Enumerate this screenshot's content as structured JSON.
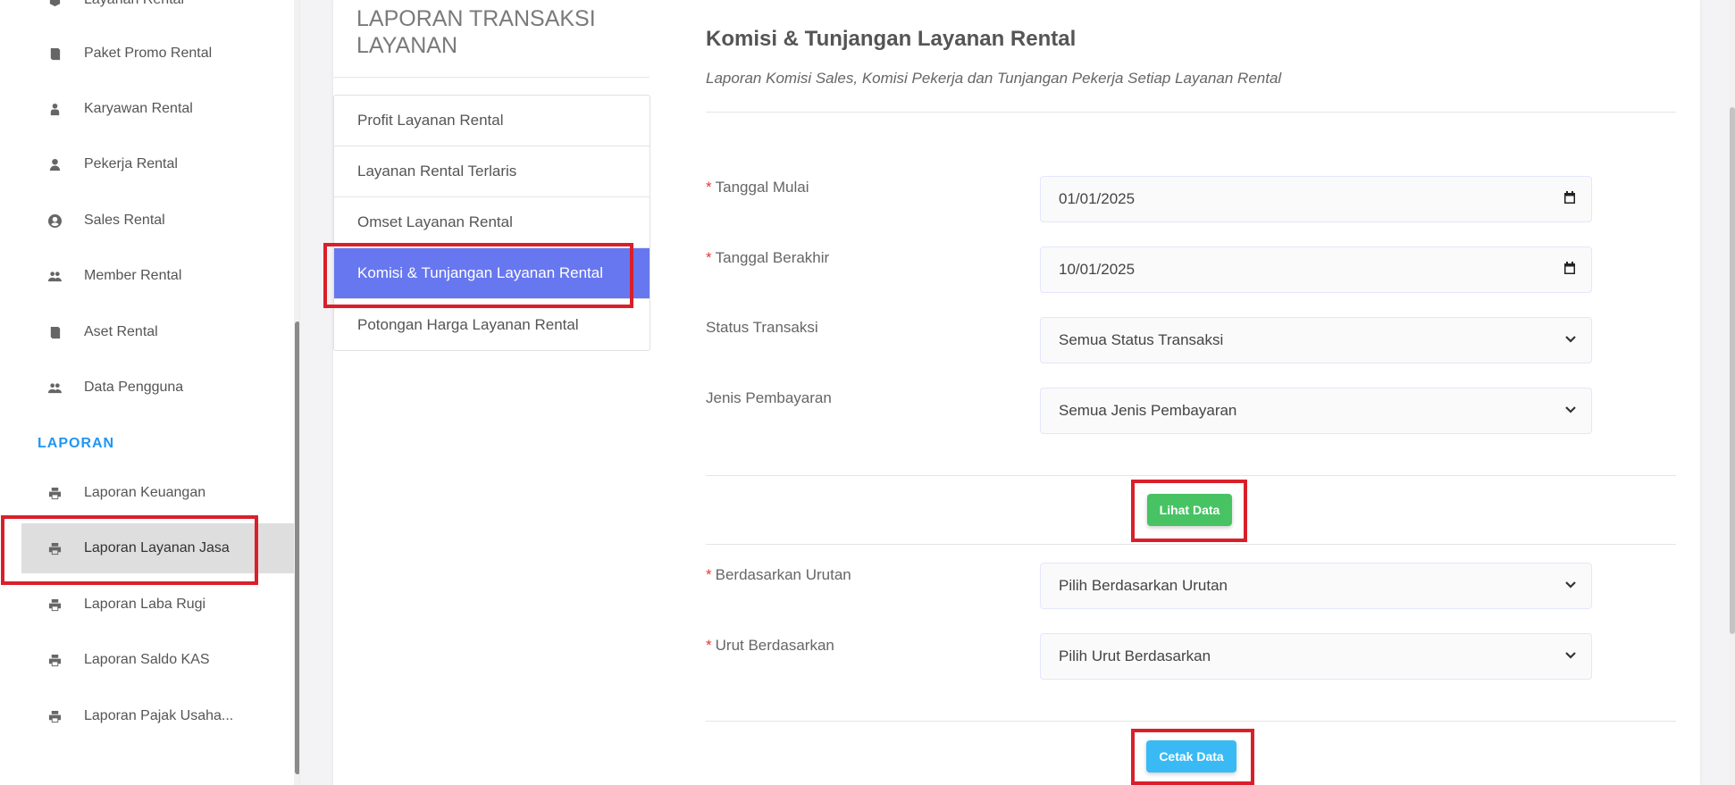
{
  "sidebar": {
    "items": [
      {
        "label": "Layanan Rental",
        "icon": "cube-icon"
      },
      {
        "label": "Paket Promo Rental",
        "icon": "book-icon"
      },
      {
        "label": "Karyawan Rental",
        "icon": "user-tie-icon"
      },
      {
        "label": "Pekerja Rental",
        "icon": "user-icon"
      },
      {
        "label": "Sales Rental",
        "icon": "user-circle-icon"
      },
      {
        "label": "Member Rental",
        "icon": "users-icon"
      },
      {
        "label": "Aset Rental",
        "icon": "book-icon"
      },
      {
        "label": "Data Pengguna",
        "icon": "users-icon"
      }
    ],
    "section_label": "LAPORAN",
    "report_items": [
      {
        "label": "Laporan Keuangan",
        "icon": "print-icon"
      },
      {
        "label": "Laporan Layanan Jasa",
        "icon": "print-icon"
      },
      {
        "label": "Laporan Laba Rugi",
        "icon": "print-icon"
      },
      {
        "label": "Laporan Saldo KAS",
        "icon": "print-icon"
      },
      {
        "label": "Laporan Pajak Usaha...",
        "icon": "print-icon"
      }
    ]
  },
  "report_menu": {
    "title": "LAPORAN TRANSAKSI LAYANAN",
    "items": [
      "Profit Layanan Rental",
      "Layanan Rental Terlaris",
      "Omset Layanan Rental",
      "Komisi & Tunjangan Layanan Rental",
      "Potongan Harga Layanan Rental"
    ],
    "active_index": 3
  },
  "form": {
    "title": "Komisi & Tunjangan Layanan Rental",
    "subtitle": "Laporan Komisi Sales, Komisi Pekerja dan Tunjangan Pekerja Setiap Layanan Rental",
    "start_date": {
      "label": "Tanggal Mulai",
      "value": "01/01/2025",
      "required": true
    },
    "end_date": {
      "label": "Tanggal Berakhir",
      "value": "10/01/2025",
      "required": true
    },
    "status": {
      "label": "Status Transaksi",
      "value": "Semua Status Transaksi"
    },
    "payment": {
      "label": "Jenis Pembayaran",
      "value": "Semua Jenis Pembayaran"
    },
    "view_button": "Lihat Data",
    "sort_by": {
      "label": "Berdasarkan Urutan",
      "value": "Pilih Berdasarkan Urutan",
      "required": true
    },
    "order_by": {
      "label": "Urut Berdasarkan",
      "value": "Pilih Urut Berdasarkan",
      "required": true
    },
    "print_button": "Cetak Data"
  },
  "colors": {
    "active_menu": "#6777ef",
    "success": "#47c363",
    "info": "#3abaf4",
    "highlight": "#d9202a",
    "section": "#2196f3",
    "required": "#e53935"
  }
}
